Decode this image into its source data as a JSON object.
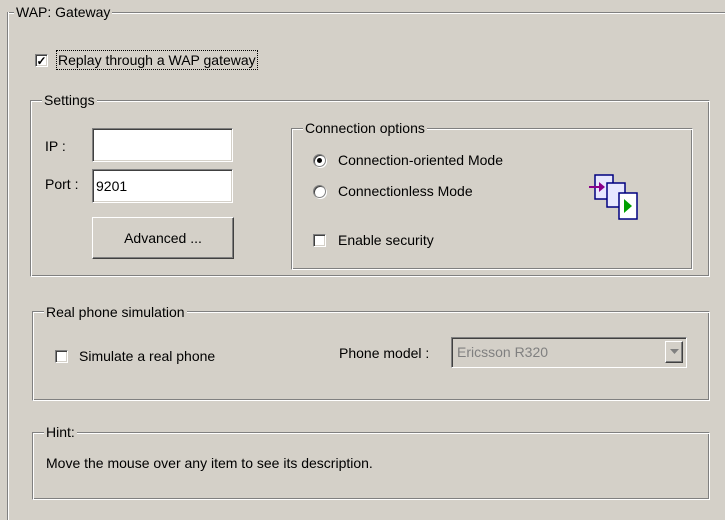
{
  "gateway": {
    "group_title": "WAP: Gateway",
    "replay_label": "Replay through a WAP gateway",
    "replay_checked": true
  },
  "settings": {
    "group_title": "Settings",
    "ip_label": "IP :",
    "ip_value": "",
    "port_label": "Port :",
    "port_value": "9201",
    "advanced_button": "Advanced ..."
  },
  "connection": {
    "group_title": "Connection options",
    "oriented_label": "Connection-oriented Mode",
    "oriented_selected": true,
    "connectionless_label": "Connectionless Mode",
    "connectionless_selected": false,
    "security_label": "Enable security",
    "security_checked": false,
    "icon": "transfer-pages-icon"
  },
  "phone": {
    "group_title": "Real phone simulation",
    "simulate_label": "Simulate a real phone",
    "simulate_checked": false,
    "model_label": "Phone model :",
    "model_value": "Ericsson R320"
  },
  "hint": {
    "group_title": "Hint:",
    "text": "Move the mouse over any item to see its description."
  }
}
